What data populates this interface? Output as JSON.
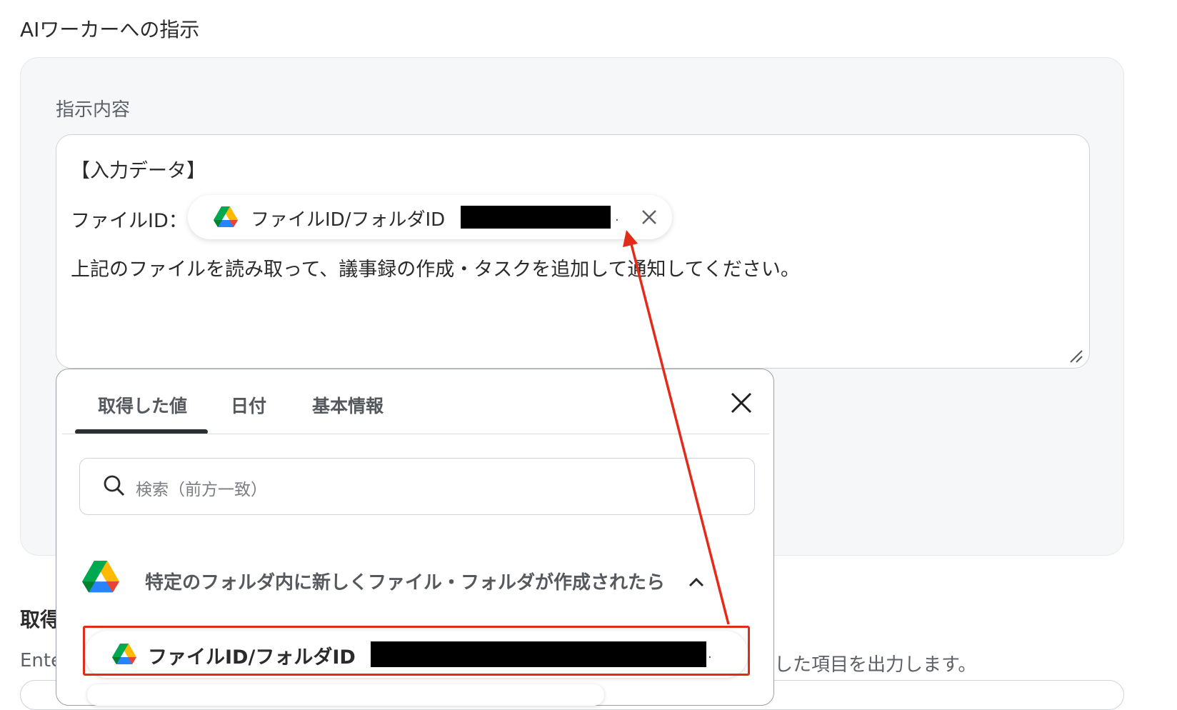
{
  "section_title": "AIワーカーへの指示",
  "panel": {
    "field_label": "指示内容",
    "textarea": {
      "line1": "【入力データ】",
      "line2_label": "ファイルID：",
      "chip_label": "ファイルID/フォルダID",
      "line3": "上記のファイルを読み取って、議事録の作成・タスクを追加して通知してください。"
    }
  },
  "popup": {
    "tabs": [
      "取得した値",
      "日付",
      "基本情報"
    ],
    "search_placeholder": "検索（前方一致）",
    "group_label": "特定のフォルダ内に新しくファイル・フォルダが作成されたら",
    "item_label": "ファイルID/フォルダID"
  },
  "background": {
    "title_partial": "取得",
    "desc_left_partial": "Ente",
    "desc_right_partial": "した項目を出力します。"
  },
  "colors": {
    "accent_red": "#e32b1a",
    "panel_bg": "#f6f7f9"
  }
}
